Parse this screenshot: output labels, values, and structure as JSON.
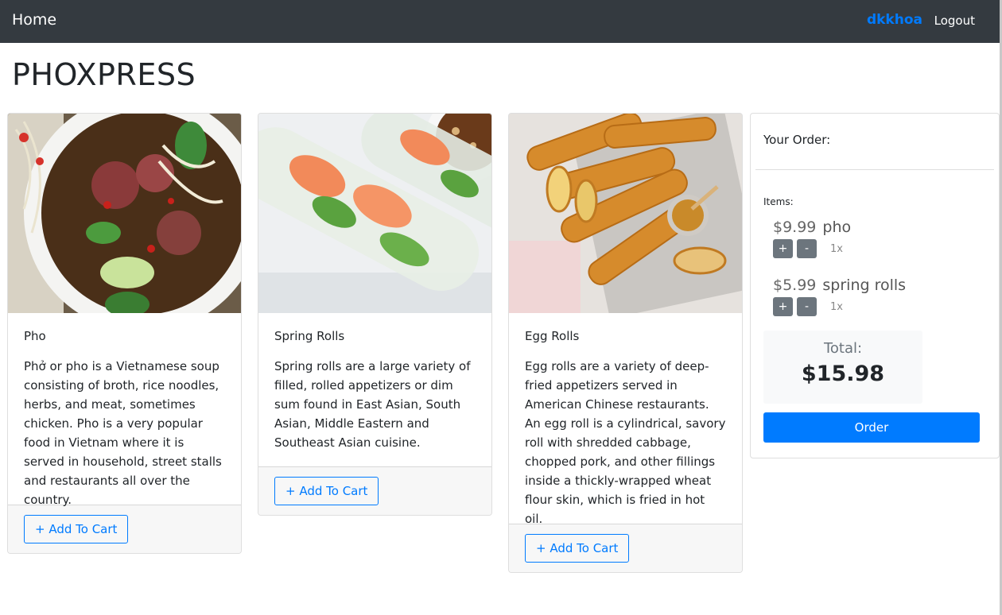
{
  "navbar": {
    "brand": "Home",
    "username": "dkkhoa",
    "logout": "Logout"
  },
  "page": {
    "title": "PHOXPRESS"
  },
  "products": [
    {
      "title": "Pho",
      "description": "Phở or pho is a Vietnamese soup consisting of broth, rice noodles, herbs, and meat, sometimes chicken. Pho is a very popular food in Vietnam where it is served in household, street stalls and restaurants all over the country.",
      "button": "+ Add To Cart"
    },
    {
      "title": "Spring Rolls",
      "description": "Spring rolls are a large variety of filled, rolled appetizers or dim sum found in East Asian, South Asian, Middle Eastern and Southeast Asian cuisine.",
      "button": "+ Add To Cart"
    },
    {
      "title": "Egg Rolls",
      "description": "Egg rolls are a variety of deep-fried appetizers served in American Chinese restaurants. An egg roll is a cylindrical, savory roll with shredded cabbage, chopped pork, and other fillings inside a thickly-wrapped wheat flour skin, which is fried in hot oil.",
      "button": "+ Add To Cart"
    }
  ],
  "order": {
    "header": "Your Order:",
    "items_label": "Items:",
    "items": [
      {
        "price": "$9.99",
        "name": "pho",
        "plus": "+",
        "minus": "-",
        "qty": "1x"
      },
      {
        "price": "$5.99",
        "name": "spring rolls",
        "plus": "+",
        "minus": "-",
        "qty": "1x"
      }
    ],
    "total_label": "Total:",
    "total_value": "$15.98",
    "order_button": "Order"
  },
  "colors": {
    "navbar": "#343a40",
    "primary": "#007bff",
    "secondary": "#6c757d",
    "footer_bg": "#f7f7f7"
  }
}
